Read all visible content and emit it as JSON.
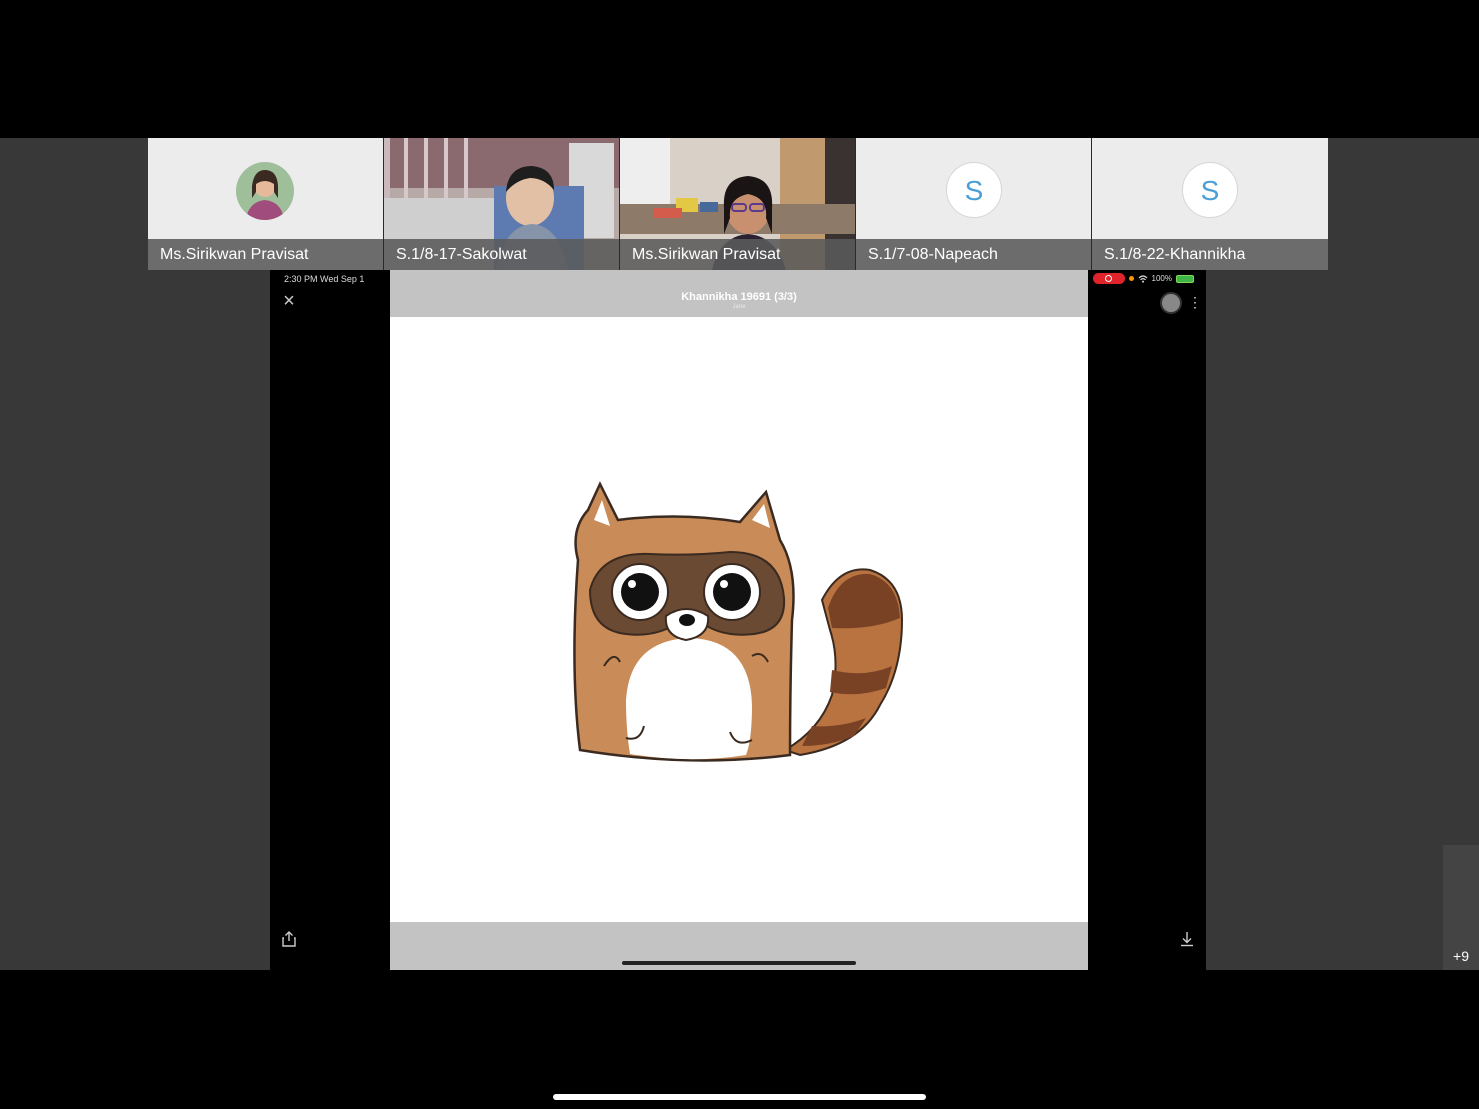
{
  "participants": [
    {
      "name": "Ms.Sirikwan Pravisat",
      "avatar": "photo-avatar"
    },
    {
      "name": "S.1/8-17-Sakolwat",
      "avatar": "video-feed"
    },
    {
      "name": "Ms.Sirikwan Pravisat",
      "avatar": "video-feed"
    },
    {
      "name": "S.1/7-08-Napeach",
      "avatar_letter": "S"
    },
    {
      "name": "S.1/8-22-Khannikha",
      "avatar_letter": "S"
    }
  ],
  "shared_screen": {
    "status_time": "2:30 PM   Wed Sep 1",
    "battery_text": "100%",
    "viewer_title": "Khannikha 19691 (3/3)",
    "viewer_subtitle": "Jane"
  },
  "more_participants": "+9",
  "icons": {
    "close": "close-icon",
    "share": "share-icon",
    "download": "download-icon",
    "more": "more-vertical-icon",
    "record": "record-icon"
  },
  "colors": {
    "stage_bg": "#383838",
    "name_bar": "#5a5a5a",
    "letter_avatar": "#4aa0d6",
    "recording": "#e0242b"
  }
}
